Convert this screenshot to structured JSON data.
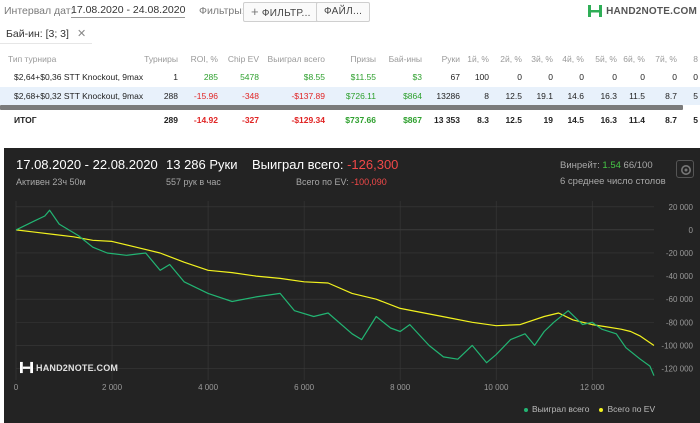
{
  "toolbar": {
    "interval_label": "Интервал дат:",
    "interval_value": "17.08.2020 - 24.08.2020",
    "filters_label": "Фильтры:",
    "filter_button": "ФИЛЬТР...",
    "file_button": "ФАЙЛ...",
    "logo_text": "HAND2NOTE.COM"
  },
  "chip": {
    "label": "Бай-ин: [3; 3]"
  },
  "table": {
    "headers": [
      "Тип турнира",
      "Турниры",
      "ROI, %",
      "Chip EV",
      "Выиграл всего",
      "Призы",
      "Бай-ины",
      "Руки",
      "1й, %",
      "2й, %",
      "3й, %",
      "4й, %",
      "5й, %",
      "6й, %",
      "7й, %",
      "8"
    ],
    "rows": [
      [
        "$2,64+$0,36 STT Knockout, 9max",
        "1",
        "285",
        "5478",
        "$8.55",
        "$11.55",
        "$3",
        "67",
        "100",
        "0",
        "0",
        "0",
        "0",
        "0",
        "0",
        "0"
      ],
      [
        "$2,68+$0,32 STT Knockout, 9max",
        "288",
        "-15.96",
        "-348",
        "-$137.89",
        "$726.11",
        "$864",
        "13286",
        "8",
        "12.5",
        "19.1",
        "14.6",
        "16.3",
        "11.5",
        "8.7",
        "5"
      ]
    ],
    "total": [
      "ИТОГ",
      "289",
      "-14.92",
      "-327",
      "-$129.34",
      "$737.66",
      "$867",
      "13 353",
      "8.3",
      "12.5",
      "19",
      "14.5",
      "16.3",
      "11.4",
      "8.7",
      "5"
    ]
  },
  "panel": {
    "dates": "17.08.2020 - 22.08.2020",
    "active": "Активен 23ч 50м",
    "hands": "13 286 Руки",
    "hands_per_hour": "557 рук в час",
    "won_label": "Выиграл всего:",
    "won_value": "-126,300",
    "ev_label": "Всего по EV:",
    "ev_value": "-100,090",
    "winrate_label": "Винрейт:",
    "winrate_value": "1.54",
    "winrate_suffix": "66/100",
    "tables_text": "6 среднее число столов",
    "watermark": "HAND2NOTE.COM"
  },
  "colors": {
    "won": "#22b573",
    "ev": "#f2f21e",
    "positive": "#2ea02e",
    "negative": "#e02424"
  },
  "chart_data": {
    "type": "line",
    "x_ticks": [
      "0",
      "2 000",
      "4 000",
      "6 000",
      "8 000",
      "10 000",
      "12 000"
    ],
    "y_ticks": [
      "20 000",
      "0",
      "-20 000",
      "-40 000",
      "-60 000",
      "-80 000",
      "-100 000",
      "-120 000"
    ],
    "xlim": [
      0,
      13286
    ],
    "ylim": [
      -130000,
      25000
    ],
    "series": [
      {
        "name": "Выиграл всего",
        "color": "#22b573",
        "x": [
          0,
          400,
          600,
          700,
          900,
          1300,
          1600,
          1900,
          2300,
          2700,
          3000,
          3200,
          3500,
          4000,
          4500,
          5000,
          5500,
          5800,
          6200,
          6500,
          7000,
          7200,
          7500,
          7800,
          8000,
          8200,
          8600,
          8900,
          9200,
          9500,
          9800,
          10000,
          10300,
          10600,
          10800,
          11000,
          11200,
          11500,
          11800,
          12000,
          12200,
          12500,
          12700,
          13000,
          13200,
          13286
        ],
        "values": [
          0,
          8000,
          12000,
          17000,
          5000,
          -5000,
          -15000,
          -20000,
          -22000,
          -20000,
          -35000,
          -30000,
          -45000,
          -55000,
          -62000,
          -58000,
          -55000,
          -70000,
          -75000,
          -72000,
          -90000,
          -95000,
          -75000,
          -85000,
          -88000,
          -82000,
          -100000,
          -110000,
          -112000,
          -100000,
          -115000,
          -108000,
          -95000,
          -90000,
          -100000,
          -88000,
          -80000,
          -70000,
          -82000,
          -80000,
          -86000,
          -90000,
          -102000,
          -112000,
          -118000,
          -126300
        ]
      },
      {
        "name": "Всего по EV",
        "color": "#f2f21e",
        "x": [
          0,
          400,
          800,
          1200,
          1600,
          2000,
          2500,
          3000,
          3500,
          4000,
          4500,
          5000,
          5500,
          6000,
          6500,
          7000,
          7500,
          8000,
          8500,
          9000,
          9500,
          10000,
          10500,
          11000,
          11300,
          11600,
          12000,
          12300,
          12600,
          12800,
          13000,
          13286
        ],
        "values": [
          0,
          -2000,
          -4000,
          -6000,
          -9000,
          -10000,
          -15000,
          -20000,
          -28000,
          -35000,
          -37000,
          -40000,
          -42000,
          -45000,
          -46000,
          -55000,
          -60000,
          -68000,
          -72000,
          -76000,
          -80000,
          -83000,
          -82000,
          -75000,
          -72000,
          -78000,
          -82000,
          -84000,
          -86000,
          -88000,
          -92000,
          -100090
        ]
      }
    ]
  }
}
